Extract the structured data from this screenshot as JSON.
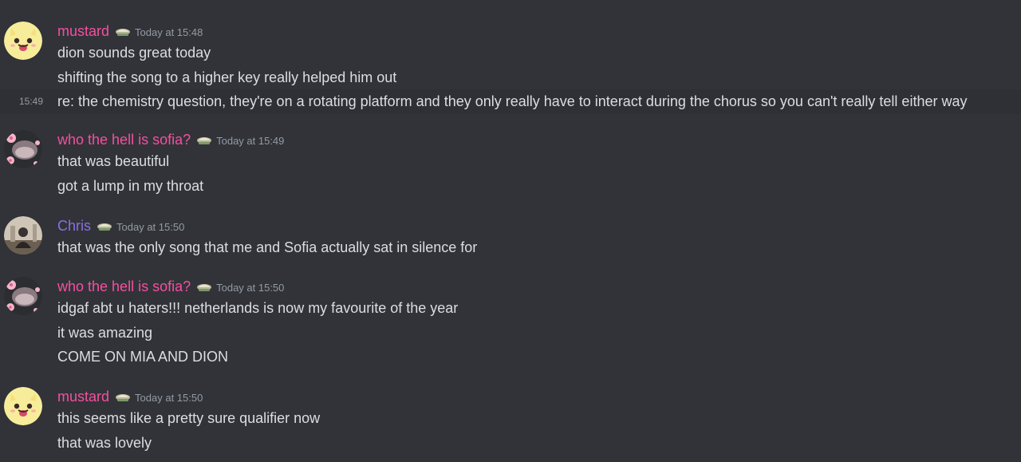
{
  "colors": {
    "background": "#313338",
    "text": "#dbdee1",
    "timestamp": "#949ba4",
    "pink": "#f54fa0",
    "purple": "#8c6fe0"
  },
  "messages": [
    {
      "username": "mustard",
      "name_color": "pink",
      "avatar": "yellow-cat-avatar",
      "timestamp": "Today at 15:48",
      "lines": [
        "dion sounds great today",
        "shifting the song to a higher key really helped him out",
        "re: the chemistry question, they're on a rotating platform and they only really have to interact during the chorus so you can't really tell either way"
      ],
      "hover_time": "15:49"
    },
    {
      "username": "who the hell is sofia?",
      "name_color": "pink",
      "avatar": "cherry-blossom-avatar",
      "timestamp": "Today at 15:49",
      "lines": [
        "that was beautiful",
        "got a lump in my throat"
      ]
    },
    {
      "username": "Chris",
      "name_color": "purple",
      "avatar": "photo-avatar",
      "timestamp": "Today at 15:50",
      "lines": [
        "that was the only song that me and Sofia actually sat in silence for"
      ]
    },
    {
      "username": "who the hell is sofia?",
      "name_color": "pink",
      "avatar": "cherry-blossom-avatar",
      "timestamp": "Today at 15:50",
      "lines": [
        "idgaf abt u haters!!! netherlands is now my favourite of the year",
        "it was amazing",
        "COME ON MIA AND DION"
      ]
    },
    {
      "username": "mustard",
      "name_color": "pink",
      "avatar": "yellow-cat-avatar",
      "timestamp": "Today at 15:50",
      "lines": [
        "this seems like a pretty sure qualifier now",
        "that was lovely"
      ]
    }
  ]
}
